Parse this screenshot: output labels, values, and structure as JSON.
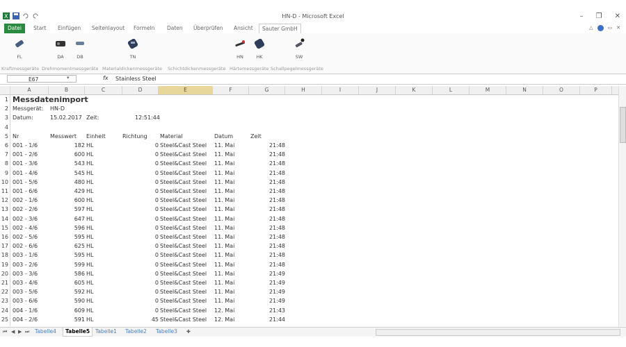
{
  "window": {
    "title": "HN-D - Microsoft Excel"
  },
  "menu": {
    "file": "Datei",
    "items": [
      "Start",
      "Einfügen",
      "Seitenlayout",
      "Formeln",
      "Daten",
      "Überprüfen",
      "Ansicht",
      "Sauter GmbH"
    ],
    "active": "Sauter GmbH"
  },
  "ribbon": {
    "buttons": [
      {
        "label": "FL",
        "icon": "force-gauge-icon"
      },
      {
        "label": "DA",
        "icon": "torque-meter-icon"
      },
      {
        "label": "DB",
        "icon": "torque-meter-b-icon"
      },
      {
        "label": "TN",
        "icon": "thickness-gauge-icon"
      },
      {
        "label": "HN",
        "icon": "hardness-tester-icon"
      },
      {
        "label": "HK",
        "icon": "hardness-k-icon"
      },
      {
        "label": "SW",
        "icon": "sound-meter-icon"
      }
    ],
    "groups": [
      "Kraftmessgeräte",
      "Drehmomentmessgeräte",
      "Materialdickenmessgeräte",
      "Schichtdickenmessgeräte",
      "Härtemessgeräte",
      "Schallpegelmessgeräte"
    ]
  },
  "formula_bar": {
    "name_box": "E67",
    "fx": "fx",
    "value": "Stainless Steel"
  },
  "columns": [
    "A",
    "B",
    "C",
    "D",
    "E",
    "F",
    "G",
    "H",
    "I",
    "J",
    "K",
    "L",
    "M",
    "N",
    "O",
    "P"
  ],
  "selected_column": "E",
  "sheet": {
    "title": "Messdatenimport",
    "device_label": "Messgerät:",
    "device_value": "HN-D",
    "date_label": "Datum:",
    "date_value": "15.02.2017",
    "time_label": "Zeit:",
    "time_value": "12:51:44",
    "headers": [
      "Nr",
      "Messwert",
      "Einheit",
      "Richtung",
      "Material",
      "Datum",
      "Zeit"
    ],
    "rows": [
      [
        "001 - 1/6",
        "182",
        "HL",
        "0",
        "Steel&Cast Steel",
        "11. Mai",
        "21:48"
      ],
      [
        "001 - 2/6",
        "600",
        "HL",
        "0",
        "Steel&Cast Steel",
        "11. Mai",
        "21:48"
      ],
      [
        "001 - 3/6",
        "543",
        "HL",
        "0",
        "Steel&Cast Steel",
        "11. Mai",
        "21:48"
      ],
      [
        "001 - 4/6",
        "545",
        "HL",
        "0",
        "Steel&Cast Steel",
        "11. Mai",
        "21:48"
      ],
      [
        "001 - 5/6",
        "480",
        "HL",
        "0",
        "Steel&Cast Steel",
        "11. Mai",
        "21:48"
      ],
      [
        "001 - 6/6",
        "429",
        "HL",
        "0",
        "Steel&Cast Steel",
        "11. Mai",
        "21:48"
      ],
      [
        "002 - 1/6",
        "600",
        "HL",
        "0",
        "Steel&Cast Steel",
        "11. Mai",
        "21:48"
      ],
      [
        "002 - 2/6",
        "597",
        "HL",
        "0",
        "Steel&Cast Steel",
        "11. Mai",
        "21:48"
      ],
      [
        "002 - 3/6",
        "647",
        "HL",
        "0",
        "Steel&Cast Steel",
        "11. Mai",
        "21:48"
      ],
      [
        "002 - 4/6",
        "596",
        "HL",
        "0",
        "Steel&Cast Steel",
        "11. Mai",
        "21:48"
      ],
      [
        "002 - 5/6",
        "595",
        "HL",
        "0",
        "Steel&Cast Steel",
        "11. Mai",
        "21:48"
      ],
      [
        "002 - 6/6",
        "625",
        "HL",
        "0",
        "Steel&Cast Steel",
        "11. Mai",
        "21:48"
      ],
      [
        "003 - 1/6",
        "595",
        "HL",
        "0",
        "Steel&Cast Steel",
        "11. Mai",
        "21:48"
      ],
      [
        "003 - 2/6",
        "599",
        "HL",
        "0",
        "Steel&Cast Steel",
        "11. Mai",
        "21:48"
      ],
      [
        "003 - 3/6",
        "586",
        "HL",
        "0",
        "Steel&Cast Steel",
        "11. Mai",
        "21:49"
      ],
      [
        "003 - 4/6",
        "605",
        "HL",
        "0",
        "Steel&Cast Steel",
        "11. Mai",
        "21:49"
      ],
      [
        "003 - 5/6",
        "592",
        "HL",
        "0",
        "Steel&Cast Steel",
        "11. Mai",
        "21:49"
      ],
      [
        "003 - 6/6",
        "590",
        "HL",
        "0",
        "Steel&Cast Steel",
        "11. Mai",
        "21:49"
      ],
      [
        "004 - 1/6",
        "609",
        "HL",
        "0",
        "Steel&Cast Steel",
        "12. Mai",
        "21:43"
      ],
      [
        "004 - 2/6",
        "591",
        "HL",
        "45",
        "Steel&Cast Steel",
        "12. Mai",
        "21:44"
      ]
    ]
  },
  "sheet_tabs": [
    "Tabelle4",
    "Tabelle5",
    "Tabelle1",
    "Tabelle2",
    "Tabelle3"
  ],
  "active_sheet": "Tabelle5",
  "colors": {
    "file_tab": "#2a8a3f",
    "selected_column": "#e8d79a",
    "sheet_tab_text": "#4a7fbf"
  }
}
